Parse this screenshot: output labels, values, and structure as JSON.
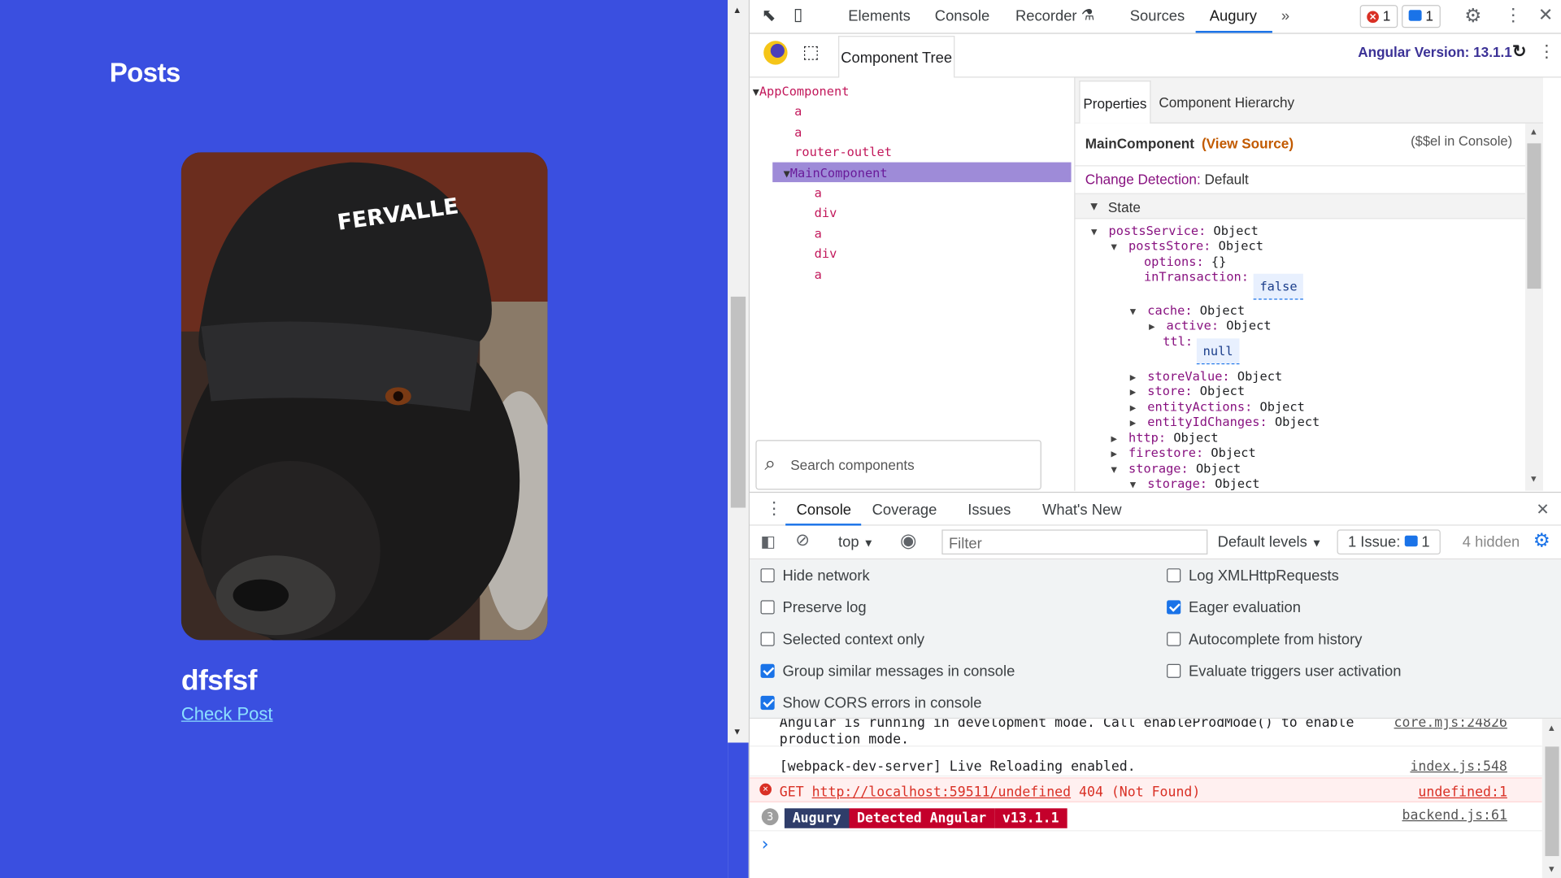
{
  "page": {
    "title": "Posts",
    "post": {
      "title": "dfsfsf",
      "link": "Check Post"
    },
    "photo_icon": "dog-wearing-cap-photo"
  },
  "devtools": {
    "tabs": [
      "Elements",
      "Console",
      "Recorder",
      "Sources",
      "Augury"
    ],
    "active_tab": "Augury",
    "more_tabs": "»",
    "error_count": "1",
    "message_count": "1",
    "augury": {
      "component_tree_tab": "Component Tree",
      "angular_version": "Angular Version: 13.1.1",
      "tree": [
        {
          "label": "AppComponent",
          "depth": 0,
          "expanded": true
        },
        {
          "label": "a",
          "depth": 1
        },
        {
          "label": "a",
          "depth": 1
        },
        {
          "label": "router-outlet",
          "depth": 1
        },
        {
          "label": "MainComponent",
          "depth": 1,
          "expanded": true,
          "selected": true
        },
        {
          "label": "a",
          "depth": 2
        },
        {
          "label": "div",
          "depth": 2
        },
        {
          "label": "a",
          "depth": 2
        },
        {
          "label": "div",
          "depth": 2
        },
        {
          "label": "a",
          "depth": 2
        }
      ],
      "search_placeholder": "Search components",
      "properties_tab": "Properties",
      "hierarchy_tab": "Component Hierarchy",
      "component_name": "MainComponent",
      "view_source": "(View Source)",
      "console_hint": "($$el in Console)",
      "change_detection_label": "Change Detection:",
      "change_detection_value": "Default",
      "state_label": "State",
      "state": [
        {
          "key": "postsService:",
          "value": "Object",
          "depth": 0,
          "toggle": "open"
        },
        {
          "key": "postsStore:",
          "value": "Object",
          "depth": 1,
          "toggle": "open"
        },
        {
          "key": "options:",
          "value": "{}",
          "depth": 2
        },
        {
          "key": "inTransaction:",
          "chip": "false",
          "depth": 2
        },
        {
          "key": "cache:",
          "value": "Object",
          "depth": 2,
          "toggle": "open"
        },
        {
          "key": "active:",
          "value": "Object",
          "depth": 3,
          "toggle": "closed"
        },
        {
          "key": "ttl:",
          "chip": "null",
          "depth": 3
        },
        {
          "key": "storeValue:",
          "value": "Object",
          "depth": 2,
          "toggle": "closed"
        },
        {
          "key": "store:",
          "value": "Object",
          "depth": 2,
          "toggle": "closed"
        },
        {
          "key": "entityActions:",
          "value": "Object",
          "depth": 2,
          "toggle": "closed"
        },
        {
          "key": "entityIdChanges:",
          "value": "Object",
          "depth": 2,
          "toggle": "closed"
        },
        {
          "key": "http:",
          "value": "Object",
          "depth": 1,
          "toggle": "closed"
        },
        {
          "key": "firestore:",
          "value": "Object",
          "depth": 1,
          "toggle": "closed"
        },
        {
          "key": "storage:",
          "value": "Object",
          "depth": 1,
          "toggle": "open"
        },
        {
          "key": "storage:",
          "value": "Object",
          "depth": 2,
          "toggle": "open"
        }
      ]
    },
    "drawer": {
      "tabs": [
        "Console",
        "Coverage",
        "Issues",
        "What's New"
      ],
      "active_tab": "Console",
      "context": "top",
      "filter_placeholder": "Filter",
      "levels": "Default levels",
      "issues": "1 Issue:",
      "issues_count": "1",
      "hidden": "4 hidden",
      "options_left": [
        {
          "label": "Hide network",
          "checked": false
        },
        {
          "label": "Preserve log",
          "checked": false
        },
        {
          "label": "Selected context only",
          "checked": false
        },
        {
          "label": "Group similar messages in console",
          "checked": true
        },
        {
          "label": "Show CORS errors in console",
          "checked": true
        }
      ],
      "options_right": [
        {
          "label": "Log XMLHttpRequests",
          "checked": false
        },
        {
          "label": "Eager evaluation",
          "checked": true
        },
        {
          "label": "Autocomplete from history",
          "checked": false
        },
        {
          "label": "Evaluate triggers user activation",
          "checked": false
        }
      ],
      "messages": [
        {
          "text": "Angular is running in development mode. Call enableProdMode() to enable",
          "text2": "production mode.",
          "source": "core.mjs:24826",
          "type": "info"
        },
        {
          "text": "[webpack-dev-server] Live Reloading enabled.",
          "source": "index.js:548",
          "type": "info"
        },
        {
          "text_prefix": "GET ",
          "url": "http://localhost:59511/undefined",
          "text_suffix": " 404 (Not Found)",
          "source": "undefined:1",
          "type": "error"
        },
        {
          "count": "3",
          "chips": [
            "Augury",
            "Detected Angular",
            "v13.1.1"
          ],
          "source": "backend.js:61",
          "type": "augury"
        }
      ],
      "prompt": "›"
    }
  }
}
